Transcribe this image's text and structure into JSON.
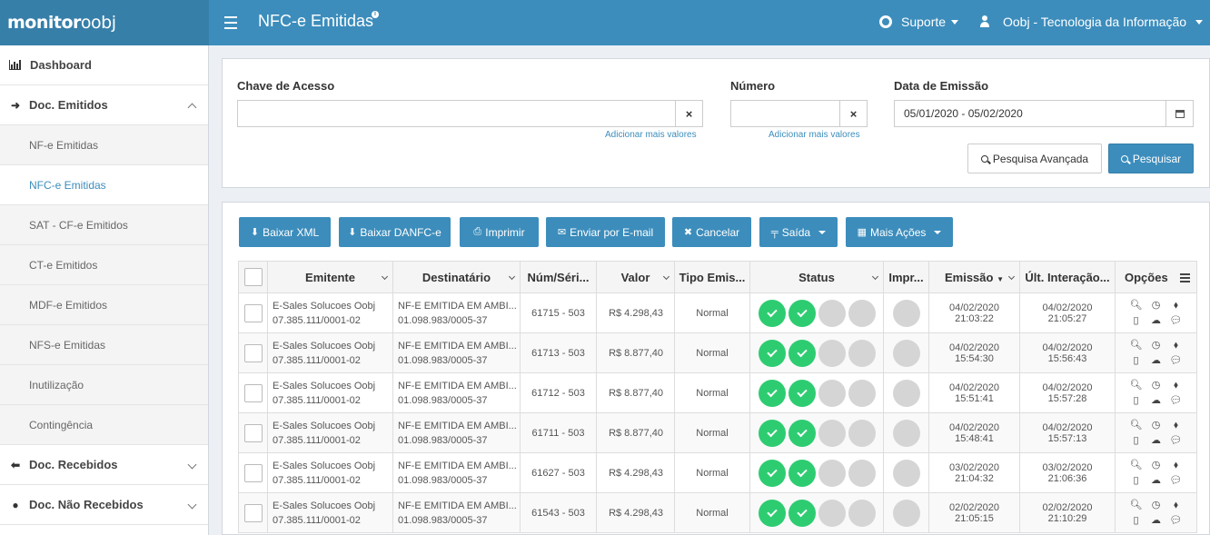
{
  "header": {
    "logo_a": "monitor",
    "logo_b": "oobj",
    "title": "NFC-e Emitidas",
    "info": "i",
    "support": "Suporte",
    "user": "Oobj - Tecnologia da Informação"
  },
  "sidebar": {
    "dashboard": "Dashboard",
    "doc_emitidos": "Doc. Emitidos",
    "items": [
      "NF-e Emitidas",
      "NFC-e Emitidas",
      "SAT - CF-e Emitidos",
      "CT-e Emitidos",
      "MDF-e Emitidos",
      "NFS-e Emitidas",
      "Inutilização",
      "Contingência"
    ],
    "doc_recebidos": "Doc. Recebidos",
    "doc_nao_recebidos": "Doc. Não Recebidos"
  },
  "filter": {
    "chave_label": "Chave de Acesso",
    "chave_value": "",
    "numero_label": "Número",
    "numero_value": "",
    "data_label": "Data de Emissão",
    "data_value": "05/01/2020 - 05/02/2020",
    "add_more": "Adicionar mais valores",
    "clear": "×",
    "advanced": "Pesquisa Avançada",
    "search": "Pesquisar"
  },
  "toolbar": {
    "baixar_xml": "Baixar XML",
    "baixar_danfce": "Baixar DANFC-e",
    "imprimir": "Imprimir",
    "enviar_email": "Enviar por E-mail",
    "cancelar": "Cancelar",
    "saida": "Saída",
    "mais_acoes": "Mais Ações"
  },
  "table": {
    "headers": [
      "Emitente",
      "Destinatário",
      "Núm/Séri...",
      "Valor",
      "Tipo Emis...",
      "Status",
      "Impr...",
      "Emissão",
      "Últ. Interação...",
      "Opções"
    ],
    "rows": [
      {
        "em1": "E-Sales Solucoes Oobj",
        "em2": "07.385.111/0001-02",
        "de1": "NF-E EMITIDA EM AMBI...",
        "de2": "01.098.983/0005-37",
        "num": "61715 - 503",
        "valor": "R$ 4.298,43",
        "tipo": "Normal",
        "e1": "04/02/2020",
        "e2": "21:03:22",
        "u1": "04/02/2020",
        "u2": "21:05:27"
      },
      {
        "em1": "E-Sales Solucoes Oobj",
        "em2": "07.385.111/0001-02",
        "de1": "NF-E EMITIDA EM AMBI...",
        "de2": "01.098.983/0005-37",
        "num": "61713 - 503",
        "valor": "R$ 8.877,40",
        "tipo": "Normal",
        "e1": "04/02/2020",
        "e2": "15:54:30",
        "u1": "04/02/2020",
        "u2": "15:56:43"
      },
      {
        "em1": "E-Sales Solucoes Oobj",
        "em2": "07.385.111/0001-02",
        "de1": "NF-E EMITIDA EM AMBI...",
        "de2": "01.098.983/0005-37",
        "num": "61712 - 503",
        "valor": "R$ 8.877,40",
        "tipo": "Normal",
        "e1": "04/02/2020",
        "e2": "15:51:41",
        "u1": "04/02/2020",
        "u2": "15:57:28"
      },
      {
        "em1": "E-Sales Solucoes Oobj",
        "em2": "07.385.111/0001-02",
        "de1": "NF-E EMITIDA EM AMBI...",
        "de2": "01.098.983/0005-37",
        "num": "61711 - 503",
        "valor": "R$ 8.877,40",
        "tipo": "Normal",
        "e1": "04/02/2020",
        "e2": "15:48:41",
        "u1": "04/02/2020",
        "u2": "15:57:13"
      },
      {
        "em1": "E-Sales Solucoes Oobj",
        "em2": "07.385.111/0001-02",
        "de1": "NF-E EMITIDA EM AMBI...",
        "de2": "01.098.983/0005-37",
        "num": "61627 - 503",
        "valor": "R$ 4.298,43",
        "tipo": "Normal",
        "e1": "03/02/2020",
        "e2": "21:04:32",
        "u1": "03/02/2020",
        "u2": "21:06:36"
      },
      {
        "em1": "E-Sales Solucoes Oobj",
        "em2": "07.385.111/0001-02",
        "de1": "NF-E EMITIDA EM AMBI...",
        "de2": "01.098.983/0005-37",
        "num": "61543 - 503",
        "valor": "R$ 4.298,43",
        "tipo": "Normal",
        "e1": "02/02/2020",
        "e2": "21:05:15",
        "u1": "02/02/2020",
        "u2": "21:10:29"
      }
    ]
  },
  "colors": {
    "brand": "#3c8dbc",
    "ok": "#2ecc71",
    "pending": "#d5d5d5"
  }
}
